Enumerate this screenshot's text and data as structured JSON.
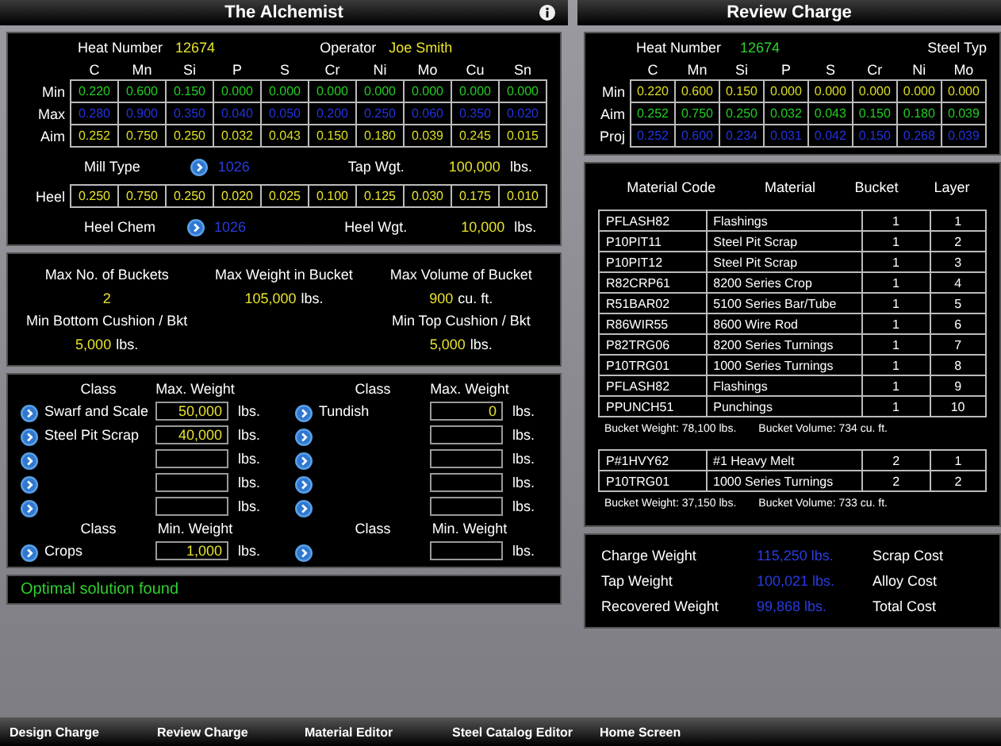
{
  "left": {
    "title": "The Alchemist",
    "heat": {
      "label": "Heat Number",
      "value": "12674"
    },
    "operator": {
      "label": "Operator",
      "value": "Joe Smith"
    },
    "elements": [
      "C",
      "Mn",
      "Si",
      "P",
      "S",
      "Cr",
      "Ni",
      "Mo",
      "Cu",
      "Sn"
    ],
    "chem_rows": [
      {
        "label": "Min",
        "color": "#22cc22",
        "values": [
          "0.220",
          "0.600",
          "0.150",
          "0.000",
          "0.000",
          "0.000",
          "0.000",
          "0.000",
          "0.000",
          "0.000"
        ]
      },
      {
        "label": "Max",
        "color": "#2233dd",
        "values": [
          "0.280",
          "0.900",
          "0.350",
          "0.040",
          "0.050",
          "0.200",
          "0.250",
          "0.060",
          "0.350",
          "0.020"
        ]
      },
      {
        "label": "Aim",
        "color": "#dddd22",
        "values": [
          "0.252",
          "0.750",
          "0.250",
          "0.032",
          "0.043",
          "0.150",
          "0.180",
          "0.039",
          "0.245",
          "0.015"
        ]
      }
    ],
    "mill_type": {
      "label": "Mill Type",
      "value": "1026"
    },
    "tap_wgt": {
      "label": "Tap Wgt.",
      "value": "100,000",
      "unit": "lbs."
    },
    "heel": {
      "label": "Heel",
      "values": [
        "0.250",
        "0.750",
        "0.250",
        "0.020",
        "0.025",
        "0.100",
        "0.125",
        "0.030",
        "0.175",
        "0.010"
      ]
    },
    "heel_chem": {
      "label": "Heel Chem",
      "value": "1026"
    },
    "heel_wgt": {
      "label": "Heel Wgt.",
      "value": "10,000",
      "unit": "lbs."
    },
    "bucket_limits": [
      {
        "label": "Max No. of Buckets",
        "value": "2"
      },
      {
        "label": "Max Weight in Bucket",
        "value": "105,000",
        "unit": "lbs."
      },
      {
        "label": "Max Volume of Bucket",
        "value": "900",
        "unit": "cu. ft."
      },
      {
        "label": "Min Bottom Cushion / Bkt",
        "value": "5,000",
        "unit": "lbs."
      },
      {
        "label": "Min Top Cushion / Bkt",
        "value": "5,000",
        "unit": "lbs."
      }
    ],
    "max_groups": [
      {
        "class_header": "Class",
        "weight_header": "Max. Weight",
        "rows": [
          {
            "name": "Swarf and Scale",
            "value": "50,000",
            "unit": "lbs."
          },
          {
            "name": "Steel Pit Scrap",
            "value": "40,000",
            "unit": "lbs."
          },
          {
            "unit": "lbs."
          },
          {
            "unit": "lbs."
          },
          {
            "unit": "lbs."
          }
        ]
      },
      {
        "class_header": "Class",
        "weight_header": "Max. Weight",
        "rows": [
          {
            "name": "Tundish",
            "value": "0",
            "unit": "lbs."
          },
          {
            "unit": "lbs."
          },
          {
            "unit": "lbs."
          },
          {
            "unit": "lbs."
          },
          {
            "unit": "lbs."
          }
        ]
      }
    ],
    "min_groups": [
      {
        "class_header": "Class",
        "weight_header": "Min. Weight",
        "rows": [
          {
            "name": "Crops",
            "value": "1,000",
            "unit": "lbs."
          }
        ]
      },
      {
        "class_header": "Class",
        "weight_header": "Min. Weight",
        "rows": [
          {
            "unit": "lbs."
          }
        ]
      }
    ],
    "status": "Optimal solution found"
  },
  "right": {
    "title": "Review Charge",
    "heat": {
      "label": "Heat Number",
      "value": "12674"
    },
    "steel_type_label": "Steel Typ",
    "elements": [
      "C",
      "Mn",
      "Si",
      "P",
      "S",
      "Cr",
      "Ni",
      "Mo"
    ],
    "chem_rows": [
      {
        "label": "Min",
        "color": "#dddd22",
        "values": [
          "0.220",
          "0.600",
          "0.150",
          "0.000",
          "0.000",
          "0.000",
          "0.000",
          "0.000"
        ]
      },
      {
        "label": "Aim",
        "color": "#22cc22",
        "values": [
          "0.252",
          "0.750",
          "0.250",
          "0.032",
          "0.043",
          "0.150",
          "0.180",
          "0.039"
        ]
      },
      {
        "label": "Proj",
        "color": "#2233dd",
        "values": [
          "0.252",
          "0.600",
          "0.234",
          "0.031",
          "0.042",
          "0.150",
          "0.268",
          "0.039"
        ]
      }
    ],
    "table": {
      "columns": [
        "Material Code",
        "Material",
        "Bucket",
        "Layer"
      ],
      "buckets": [
        {
          "rows": [
            [
              "PFLASH82",
              "Flashings",
              "1",
              "1"
            ],
            [
              "P10PIT11",
              "Steel Pit Scrap",
              "1",
              "2"
            ],
            [
              "P10PIT12",
              "Steel Pit Scrap",
              "1",
              "3"
            ],
            [
              "R82CRP61",
              "8200 Series Crop",
              "1",
              "4"
            ],
            [
              "R51BAR02",
              "5100 Series Bar/Tube",
              "1",
              "5"
            ],
            [
              "R86WIR55",
              "8600 Wire Rod",
              "1",
              "6"
            ],
            [
              "P82TRG06",
              "8200 Series Turnings",
              "1",
              "7"
            ],
            [
              "P10TRG01",
              "1000 Series Turnings",
              "1",
              "8"
            ],
            [
              "PFLASH82",
              "Flashings",
              "1",
              "9"
            ],
            [
              "PPUNCH51",
              "Punchings",
              "1",
              "10"
            ]
          ],
          "weight": "Bucket Weight: 78,100 lbs.",
          "volume": "Bucket Volume: 734 cu. ft."
        },
        {
          "rows": [
            [
              "P#1HVY62",
              "#1 Heavy Melt",
              "2",
              "1"
            ],
            [
              "P10TRG01",
              "1000 Series Turnings",
              "2",
              "2"
            ]
          ],
          "weight": "Bucket Weight: 37,150 lbs.",
          "volume": "Bucket Volume: 733 cu. ft."
        }
      ]
    },
    "summary": [
      {
        "label": "Charge Weight",
        "value": "115,250 lbs.",
        "cost_label": "Scrap Cost"
      },
      {
        "label": "Tap Weight",
        "value": "100,021 lbs.",
        "cost_label": "Alloy Cost"
      },
      {
        "label": "Recovered Weight",
        "value": "99,868 lbs.",
        "cost_label": "Total Cost"
      }
    ]
  },
  "tabs": [
    {
      "label": "Design Charge",
      "selected": false
    },
    {
      "label": "Review Charge",
      "selected": false
    },
    {
      "label": "Material Editor",
      "selected": false
    },
    {
      "label": "Steel Catalog Editor",
      "selected": false
    },
    {
      "label": "Home Screen",
      "selected": false
    }
  ]
}
